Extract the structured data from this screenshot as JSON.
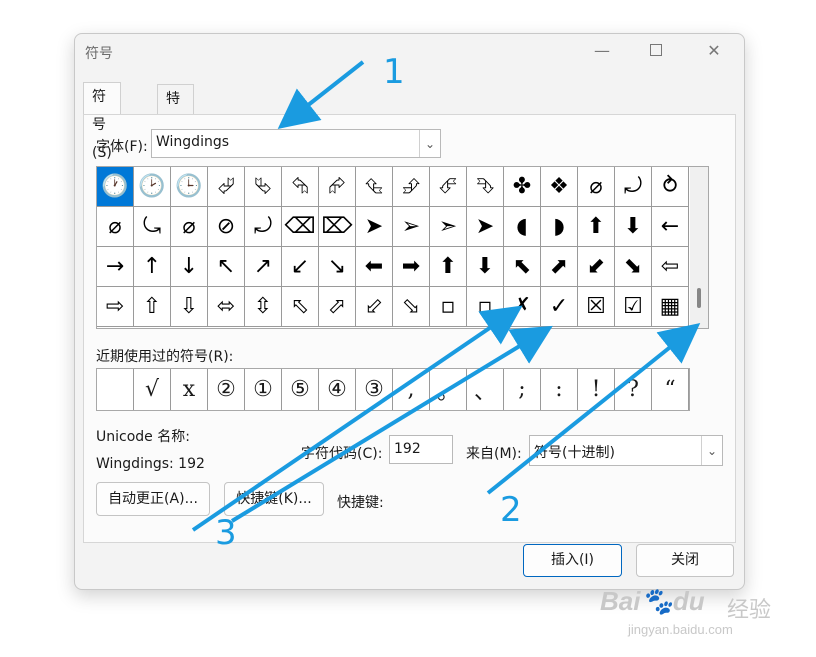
{
  "dialog": {
    "title": "符号",
    "window_controls": [
      "minimize",
      "maximize",
      "close"
    ]
  },
  "tabs": [
    {
      "label": "符号(S)",
      "active": true
    },
    {
      "label": "特殊字符(P)",
      "active": false
    }
  ],
  "font": {
    "label": "字体(F):",
    "value": "Wingdings"
  },
  "symbol_grid": {
    "selected_index": 0,
    "rows": [
      [
        "🕐",
        "🕑",
        "🕒",
        "⮰",
        "⮱",
        "⮲",
        "⮳",
        "⮴",
        "⮵",
        "⮶",
        "⮷",
        "✤",
        "❖",
        "⌀",
        "⤾",
        "⥁"
      ],
      [
        "⌀",
        "⤿",
        "⌀",
        "⊘",
        "⤾",
        "⌫",
        "⌦",
        "➤",
        "➢",
        "➣",
        "➤",
        "◖",
        "◗",
        "⬆",
        "⬇",
        "←"
      ],
      [
        "→",
        "↑",
        "↓",
        "↖",
        "↗",
        "↙",
        "↘",
        "⬅",
        "➡",
        "⬆",
        "⬇",
        "⬉",
        "⬈",
        "⬋",
        "⬊",
        "⇦"
      ],
      [
        "⇨",
        "⇧",
        "⇩",
        "⬄",
        "⇳",
        "⬁",
        "⬀",
        "⬃",
        "⬂",
        "▫",
        "▫",
        "✗",
        "✓",
        "☒",
        "☑",
        "▦"
      ]
    ]
  },
  "recent": {
    "label": "近期使用过的符号(R):",
    "symbols": [
      "",
      "√",
      "x",
      "②",
      "①",
      "⑤",
      "④",
      "③",
      ",",
      "。",
      "、",
      ";",
      ":",
      "!",
      "?",
      "“"
    ]
  },
  "unicode_name": {
    "label": "Unicode 名称:",
    "value": "Wingdings: 192"
  },
  "char_code": {
    "label": "字符代码(C):",
    "value": "192"
  },
  "from": {
    "label": "来自(M):",
    "value": "符号(十进制)"
  },
  "buttons": {
    "autocorrect": "自动更正(A)...",
    "shortcut_key_button": "快捷键(K)...",
    "shortcut_key_label": "快捷键:",
    "insert": "插入(I)",
    "close": "关闭"
  },
  "annotations": [
    "1",
    "2",
    "3"
  ],
  "watermark": {
    "brand": "Bai",
    "brand2": "du",
    "cn": "经验",
    "url": "jingyan.baidu.com"
  },
  "colors": {
    "accent": "#0078d7",
    "annotation": "#1a9be0"
  }
}
